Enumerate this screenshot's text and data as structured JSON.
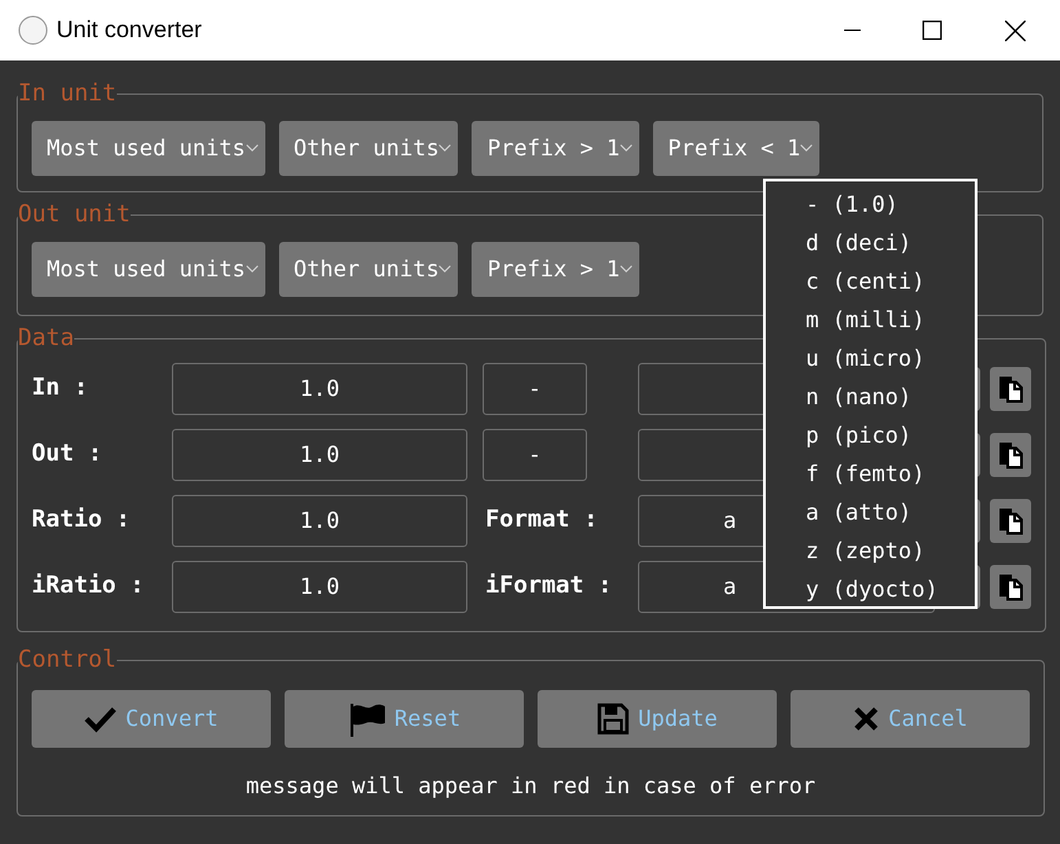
{
  "window": {
    "title": "Unit converter"
  },
  "in_unit": {
    "legend": "In unit",
    "dropdowns": [
      "Most used units",
      "Other units",
      "Prefix > 1",
      "Prefix < 1"
    ]
  },
  "out_unit": {
    "legend": "Out unit",
    "dropdowns": [
      "Most used units",
      "Other units",
      "Prefix > 1"
    ]
  },
  "data": {
    "legend": "Data",
    "rows": [
      {
        "kind": "unit",
        "label": "In :",
        "value": "1.0",
        "prefix": "-"
      },
      {
        "kind": "unit",
        "label": "Out :",
        "value": "1.0",
        "prefix": "-"
      },
      {
        "kind": "format",
        "label": "Ratio :",
        "value": "1.0",
        "format_label": "Format :",
        "format_value": "a"
      },
      {
        "kind": "format",
        "label": "iRatio :",
        "value": "1.0",
        "format_label": "iFormat :",
        "format_value": "a"
      }
    ]
  },
  "control": {
    "legend": "Control",
    "buttons": [
      {
        "kind": "check",
        "label": "Convert"
      },
      {
        "kind": "flag",
        "label": "Reset"
      },
      {
        "kind": "save",
        "label": "Update"
      },
      {
        "kind": "cross",
        "label": "Cancel"
      }
    ],
    "message": "message will appear in red in case of error"
  },
  "prefix_menu": {
    "items": [
      "- (1.0)",
      "d (deci)",
      "c (centi)",
      "m (milli)",
      "u (micro)",
      "n (nano)",
      "p (pico)",
      "f (femto)",
      "a (atto)",
      "z (zepto)",
      "y (dyocto)"
    ]
  }
}
